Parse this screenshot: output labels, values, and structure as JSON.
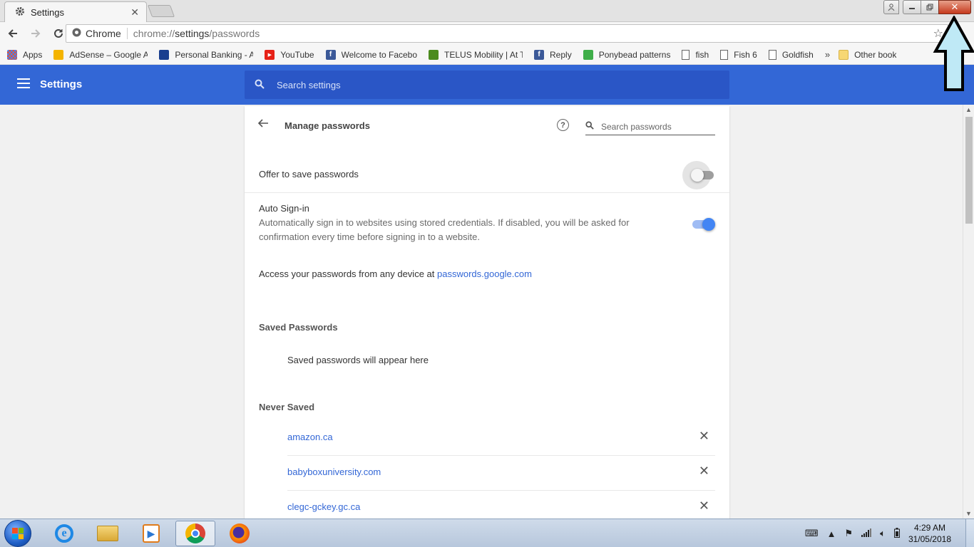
{
  "browser": {
    "tab_title": "Settings",
    "tab_close": "✕",
    "window_close": "✕",
    "omnibox_label": "Chrome",
    "url_prefix": "chrome://",
    "url_host": "settings",
    "url_path": "/passwords"
  },
  "bookmarks": [
    {
      "label": "Apps",
      "icon": "apps-grid-icon",
      "color": "#e0533a"
    },
    {
      "label": "AdSense – Google A",
      "icon": "adsense-icon",
      "color": "#f4b400"
    },
    {
      "label": "Personal Banking - A",
      "icon": "bank-icon",
      "color": "#1a3f8f"
    },
    {
      "label": "YouTube",
      "icon": "youtube-icon",
      "color": "#e62117"
    },
    {
      "label": "Welcome to Facebo",
      "icon": "facebook-icon",
      "color": "#3b5998"
    },
    {
      "label": "TELUS Mobility | At T",
      "icon": "telus-icon",
      "color": "#4b8b1e"
    },
    {
      "label": "Reply",
      "icon": "facebook-icon",
      "color": "#3b5998"
    },
    {
      "label": "Ponybead patterns",
      "icon": "ponybead-icon",
      "color": "#3fae49"
    },
    {
      "label": "fish",
      "icon": "page-icon",
      "color": "#ffffff"
    },
    {
      "label": "Fish 6",
      "icon": "page-icon",
      "color": "#ffffff"
    },
    {
      "label": "Goldfish",
      "icon": "page-icon",
      "color": "#ffffff"
    }
  ],
  "bookmarks_more": "»",
  "bookmarks_other": "Other book",
  "settings": {
    "title": "Settings",
    "search_placeholder": "Search settings"
  },
  "passwords": {
    "title": "Manage passwords",
    "search_placeholder": "Search passwords",
    "offer_label": "Offer to save passwords",
    "offer_enabled": false,
    "autosignin_label": "Auto Sign-in",
    "autosignin_desc": "Automatically sign in to websites using stored credentials. If disabled, you will be asked for confirmation every time before signing in to a website.",
    "autosignin_enabled": true,
    "access_text": "Access your passwords from any device at ",
    "access_link": "passwords.google.com",
    "saved_title": "Saved Passwords",
    "saved_empty": "Saved passwords will appear here",
    "never_title": "Never Saved",
    "never_saved": [
      {
        "site": "amazon.ca"
      },
      {
        "site": "babyboxuniversity.com"
      },
      {
        "site": "clegc-gckey.gc.ca"
      }
    ]
  },
  "taskbar": {
    "time": "4:29 AM",
    "date": "31/05/2018"
  },
  "colors": {
    "header_blue": "#3367d6",
    "link_blue": "#3367d6",
    "toggle_on": "#4285f4"
  }
}
